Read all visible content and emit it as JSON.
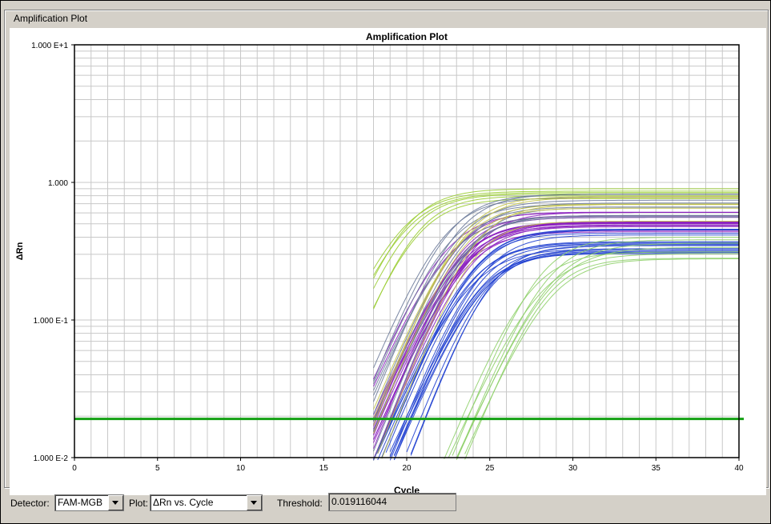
{
  "panel": {
    "title": "Amplification Plot"
  },
  "chart_data": {
    "type": "line",
    "title": "Amplification Plot",
    "xlabel": "Cycle",
    "ylabel": "ΔRn",
    "xlim": [
      0,
      40
    ],
    "ylim": [
      0.01,
      10
    ],
    "yscale": "log",
    "grid": true,
    "x_ticks": [
      "0",
      "5",
      "10",
      "15",
      "20",
      "25",
      "30",
      "35",
      "40"
    ],
    "y_ticks": [
      "1.000 E-2",
      "1.000 E-1",
      "1.000",
      "1.000 E+1"
    ],
    "threshold": 0.019116044,
    "threshold_color": "#14a014",
    "series_groups": [
      {
        "color": "#9acd32",
        "count": 6,
        "threshold_cycle": [
          25.3,
          26.1
        ],
        "plateau": [
          0.75,
          0.92
        ]
      },
      {
        "color": "#8b1fbf",
        "count": 20,
        "threshold_cycle": [
          27.4,
          28.6
        ],
        "plateau": [
          0.42,
          0.62
        ]
      },
      {
        "color": "#1f3fd0",
        "count": 18,
        "threshold_cycle": [
          28.0,
          29.2
        ],
        "plateau": [
          0.3,
          0.48
        ]
      },
      {
        "color": "#6d7b9a",
        "count": 12,
        "threshold_cycle": [
          27.6,
          28.9
        ],
        "plateau": [
          0.55,
          0.85
        ]
      },
      {
        "color": "#c6c64a",
        "count": 6,
        "threshold_cycle": [
          27.8,
          29.0
        ],
        "plateau": [
          0.5,
          0.8
        ]
      },
      {
        "color": "#8fd06a",
        "count": 8,
        "threshold_cycle": [
          31.3,
          33.2
        ],
        "plateau": [
          0.25,
          0.42
        ]
      }
    ]
  },
  "controls": {
    "detector_label": "Detector:",
    "detector_value": "FAM-MGB",
    "plot_label": "Plot:",
    "plot_value": "ΔRn vs. Cycle",
    "threshold_label": "Threshold:",
    "threshold_value": "0.019116044"
  }
}
